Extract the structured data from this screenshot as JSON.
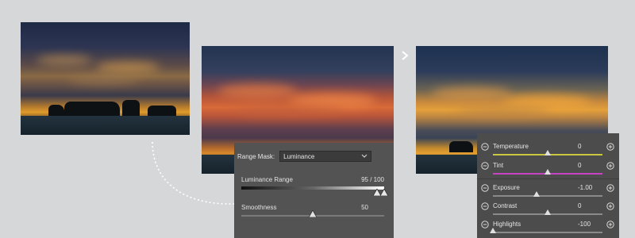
{
  "range_mask": {
    "label": "Range Mask:",
    "selected_option": "Luminance",
    "luminance_range": {
      "label": "Luminance Range",
      "value_text": "95 / 100",
      "low": 95,
      "high": 100
    },
    "smoothness": {
      "label": "Smoothness",
      "value_text": "50",
      "value": 50
    }
  },
  "adjustments": {
    "temperature": {
      "label": "Temperature",
      "value_text": "0",
      "level": 0.5,
      "track_color": "#c9c640"
    },
    "tint": {
      "label": "Tint",
      "value_text": "0",
      "level": 0.5,
      "track_color": "#c644c4"
    },
    "exposure": {
      "label": "Exposure",
      "value_text": "-1.00",
      "level": 0.4,
      "track_color": "#8a8a8a"
    },
    "contrast": {
      "label": "Contrast",
      "value_text": "0",
      "level": 0.5,
      "track_color": "#8a8a8a"
    },
    "highlights": {
      "label": "Highlights",
      "value_text": "-100",
      "level": 0.0,
      "track_color": "#8a8a8a"
    }
  },
  "icons": {
    "next": "chevron-right-icon",
    "dropdown": "chevron-down-icon",
    "decrease": "minus-circle-icon",
    "increase": "plus-circle-icon"
  }
}
